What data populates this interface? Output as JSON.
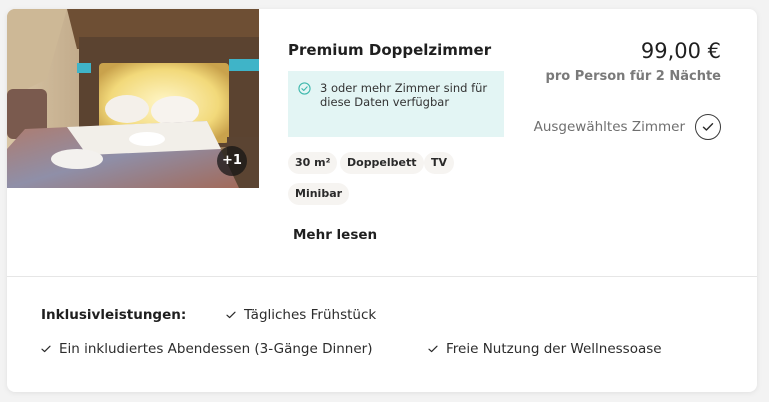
{
  "room": {
    "title": "Premium Doppelzimmer",
    "photo_more": "+1",
    "availability": "3 oder mehr Zimmer sind für diese Daten verfügbar",
    "tags": [
      "30 m²",
      "Doppelbett",
      "TV",
      "Minibar"
    ],
    "read_more": "Mehr lesen"
  },
  "pricing": {
    "price": "99,00 €",
    "price_note": "pro Person für 2 Nächte",
    "selected_label": "Ausgewähltes Zimmer"
  },
  "inclusions": {
    "title": "Inklusivleistungen:",
    "items": [
      "Tägliches Frühstück",
      "Ein inkludiertes Abendessen (3-Gänge Dinner)",
      "Freie Nutzung der Wellnessoase"
    ]
  },
  "colors": {
    "availability_bg": "#e3f5f4",
    "availability_icon": "#3fb8ad",
    "tag_bg": "#f6f4f1",
    "muted_text": "#7a7a7a"
  },
  "icons": {
    "availability": "check-circle-icon",
    "selected": "check-icon",
    "inclusion": "check-icon"
  }
}
